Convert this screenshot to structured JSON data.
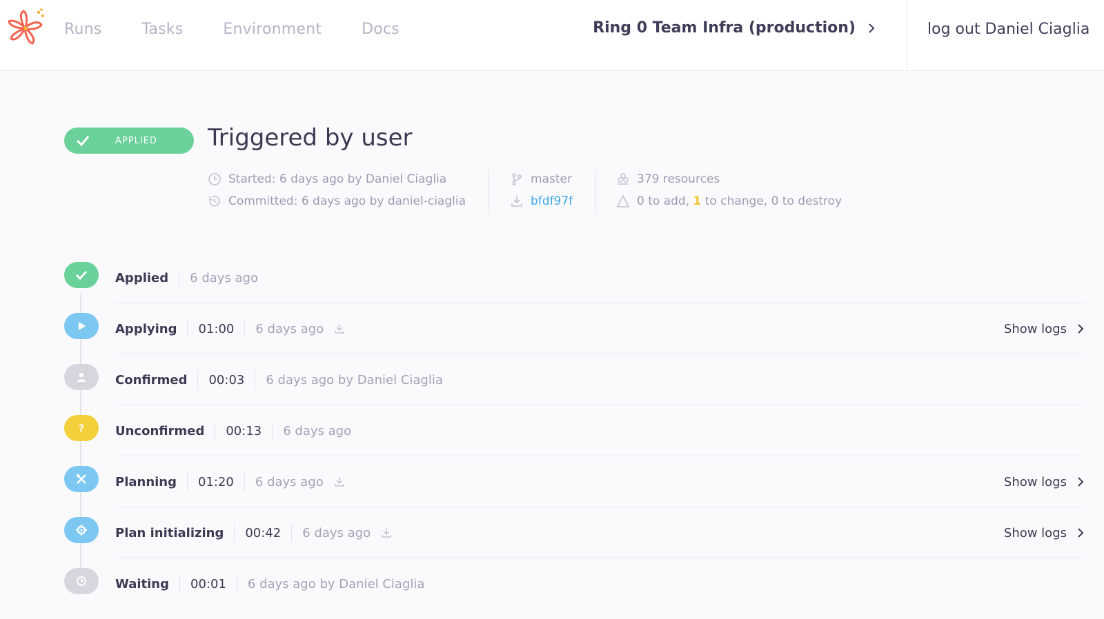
{
  "nav": {
    "items": [
      "Runs",
      "Tasks",
      "Environment",
      "Docs"
    ],
    "workspace": "Ring 0 Team Infra (production)",
    "logout": "log out Daniel Ciaglia"
  },
  "header": {
    "badge": "APPLIED",
    "title": "Triggered by user"
  },
  "meta": {
    "started": "Started: 6 days ago by Daniel Ciaglia",
    "committed": "Committed: 6 days ago by daniel-ciaglia",
    "branch": "master",
    "commit": "bfdf97f",
    "resources": "379 resources",
    "changes_pre": "0 to add,",
    "changes_count": "1",
    "changes_post": "to change, 0 to destroy"
  },
  "colors": {
    "green": "#6ad19a",
    "blue": "#7cc8f2",
    "gray": "#d6d6de",
    "yellow": "#f3cf3a",
    "link": "#3ba8e3"
  },
  "steps": [
    {
      "name": "Applied",
      "when": "6 days ago",
      "icon": "check-icon"
    },
    {
      "name": "Applying",
      "duration": "01:00",
      "when": "6 days ago",
      "logs": "Show logs",
      "icon": "play-icon"
    },
    {
      "name": "Confirmed",
      "duration": "00:03",
      "when": "6 days ago by Daniel Ciaglia",
      "icon": "user-icon"
    },
    {
      "name": "Unconfirmed",
      "duration": "00:13",
      "when": "6 days ago",
      "icon": "question-icon"
    },
    {
      "name": "Planning",
      "duration": "01:20",
      "when": "6 days ago",
      "logs": "Show logs",
      "icon": "tools-icon"
    },
    {
      "name": "Plan initializing",
      "duration": "00:42",
      "when": "6 days ago",
      "logs": "Show logs",
      "icon": "gear-icon"
    },
    {
      "name": "Waiting",
      "duration": "00:01",
      "when": "6 days ago by Daniel Ciaglia",
      "icon": "clock-icon"
    }
  ]
}
